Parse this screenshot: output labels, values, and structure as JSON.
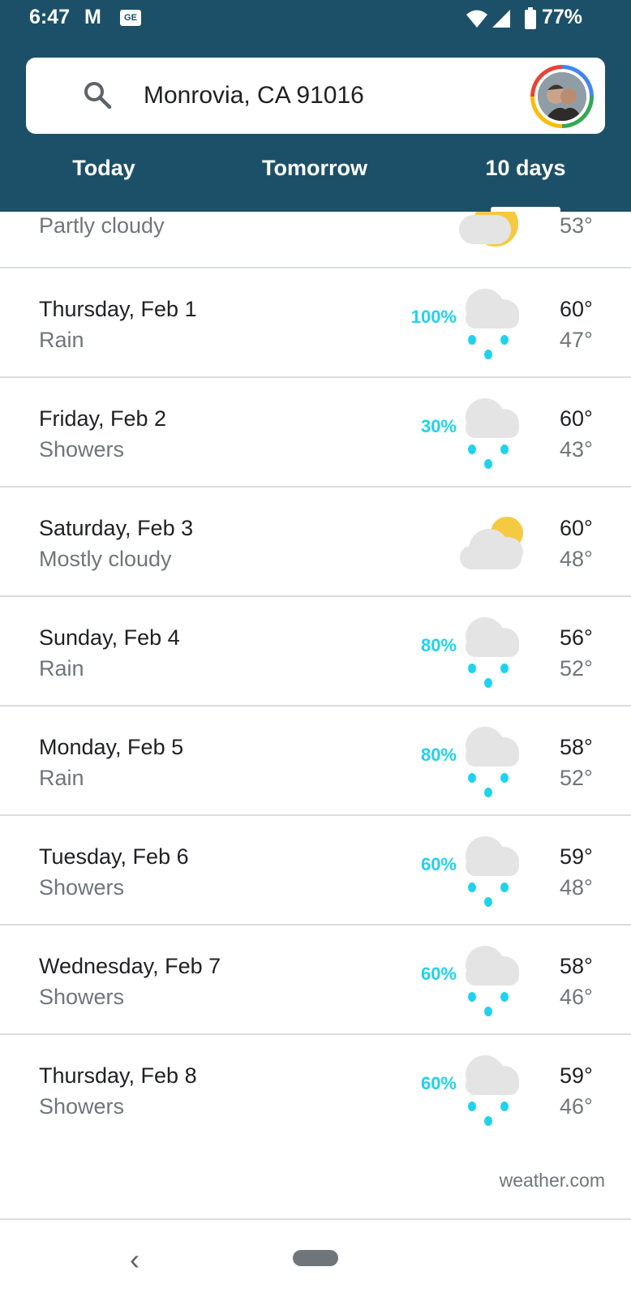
{
  "status_bar": {
    "time": "6:47",
    "mail_glyph": "M",
    "ge_badge": "GE",
    "battery": "77%",
    "icons": [
      "gmail-icon",
      "ge-news-icon",
      "wifi-icon",
      "signal-icon",
      "battery-icon"
    ]
  },
  "search": {
    "location": "Monrovia, CA 91016",
    "icon": "search-icon",
    "avatar_ring_colors": [
      "#4285f4",
      "#34a853",
      "#fbbc05",
      "#ea4335"
    ]
  },
  "tabs": {
    "items": [
      {
        "label": "Today",
        "selected": false
      },
      {
        "label": "Tomorrow",
        "selected": false
      },
      {
        "label": "10 days",
        "selected": true
      }
    ]
  },
  "forecast": {
    "partial_row": {
      "condition": "Partly cloudy",
      "icon": "partly-cloudy-icon",
      "low": "53°"
    },
    "days": [
      {
        "day": "Thursday, Feb 1",
        "condition": "Rain",
        "precip": "100%",
        "icon": "rain-icon",
        "high": "60°",
        "low": "47°"
      },
      {
        "day": "Friday, Feb 2",
        "condition": "Showers",
        "precip": "30%",
        "icon": "rain-icon",
        "high": "60°",
        "low": "43°"
      },
      {
        "day": "Saturday, Feb 3",
        "condition": "Mostly cloudy",
        "precip": "",
        "icon": "mostly-cloudy-icon",
        "high": "60°",
        "low": "48°"
      },
      {
        "day": "Sunday, Feb 4",
        "condition": "Rain",
        "precip": "80%",
        "icon": "rain-icon",
        "high": "56°",
        "low": "52°"
      },
      {
        "day": "Monday, Feb 5",
        "condition": "Rain",
        "precip": "80%",
        "icon": "rain-icon",
        "high": "58°",
        "low": "52°"
      },
      {
        "day": "Tuesday, Feb 6",
        "condition": "Showers",
        "precip": "60%",
        "icon": "rain-icon",
        "high": "59°",
        "low": "48°"
      },
      {
        "day": "Wednesday, Feb 7",
        "condition": "Showers",
        "precip": "60%",
        "icon": "rain-icon",
        "high": "58°",
        "low": "46°"
      },
      {
        "day": "Thursday, Feb 8",
        "condition": "Showers",
        "precip": "60%",
        "icon": "rain-icon",
        "high": "59°",
        "low": "46°"
      }
    ],
    "source": "weather.com"
  },
  "nav": {
    "back_glyph": "‹",
    "icons": [
      "back-icon",
      "home-pill-icon"
    ]
  },
  "colors": {
    "header": "#1c5068",
    "precip": "#1fd2ee",
    "cloud": "#e4e4e4",
    "sun": "#f6c943",
    "divider": "#dadce0"
  }
}
